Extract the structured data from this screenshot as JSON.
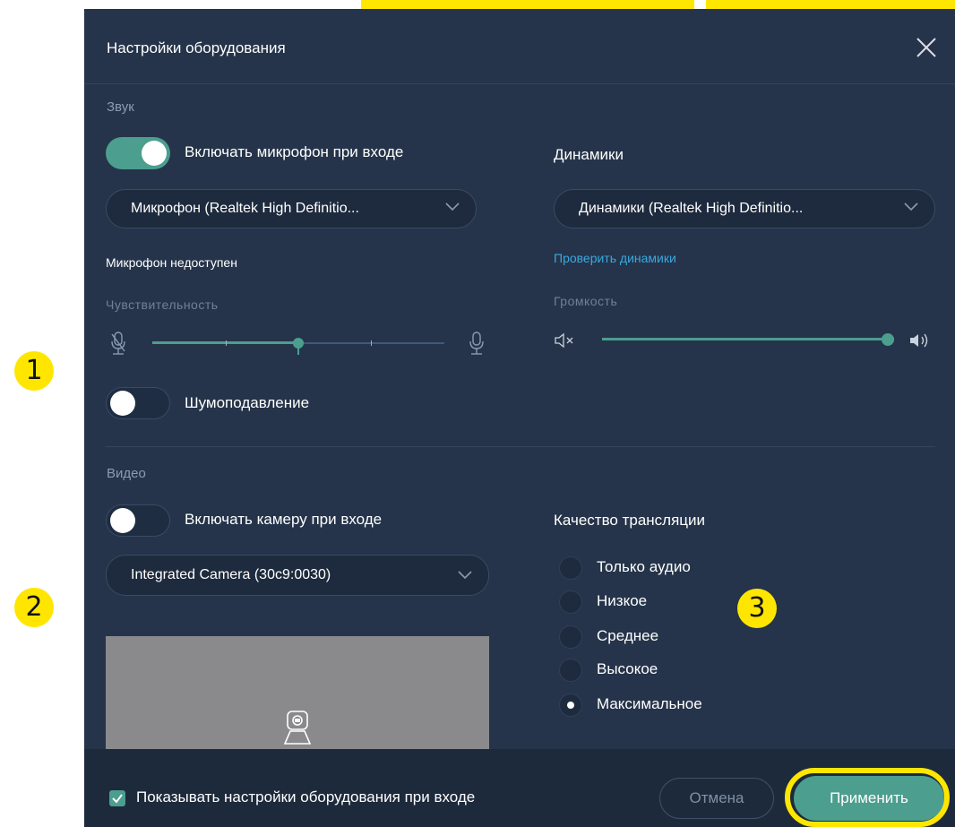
{
  "dialog": {
    "title": "Настройки оборудования"
  },
  "sound": {
    "section_label": "Звук",
    "mic_toggle_label": "Включать микрофон при входе",
    "mic_toggle_on": true,
    "mic_select_value": "Микрофон (Realtek High Definitio...",
    "mic_status": "Микрофон недоступен",
    "sensitivity_label": "Чувствительность",
    "sensitivity_level": 0.5,
    "noise_toggle_label": "Шумоподавление",
    "noise_toggle_on": false,
    "speakers_label": "Динамики",
    "speakers_select_value": "Динамики (Realtek High Definitio...",
    "check_speakers_link": "Проверить динамики",
    "volume_label": "Громкость",
    "volume_level": 1.0
  },
  "video": {
    "section_label": "Видео",
    "camera_toggle_label": "Включать камеру при входе",
    "camera_toggle_on": false,
    "camera_select_value": "Integrated Camera (30c9:0030)",
    "quality_label": "Качество трансляции",
    "quality_options": [
      "Только аудио",
      "Низкое",
      "Среднее",
      "Высокое",
      "Максимальное"
    ],
    "quality_selected": "Максимальное"
  },
  "footer": {
    "show_settings_label": "Показывать настройки оборудования при входе",
    "show_settings_checked": true,
    "cancel_label": "Отмена",
    "apply_label": "Применить"
  },
  "annotations": {
    "marker_1": "1",
    "marker_2": "2",
    "marker_3": "3"
  },
  "colors": {
    "panel_bg": "#25344a",
    "accent": "#4c9e8f",
    "link": "#3aa8e0",
    "highlight": "#ffe600"
  }
}
